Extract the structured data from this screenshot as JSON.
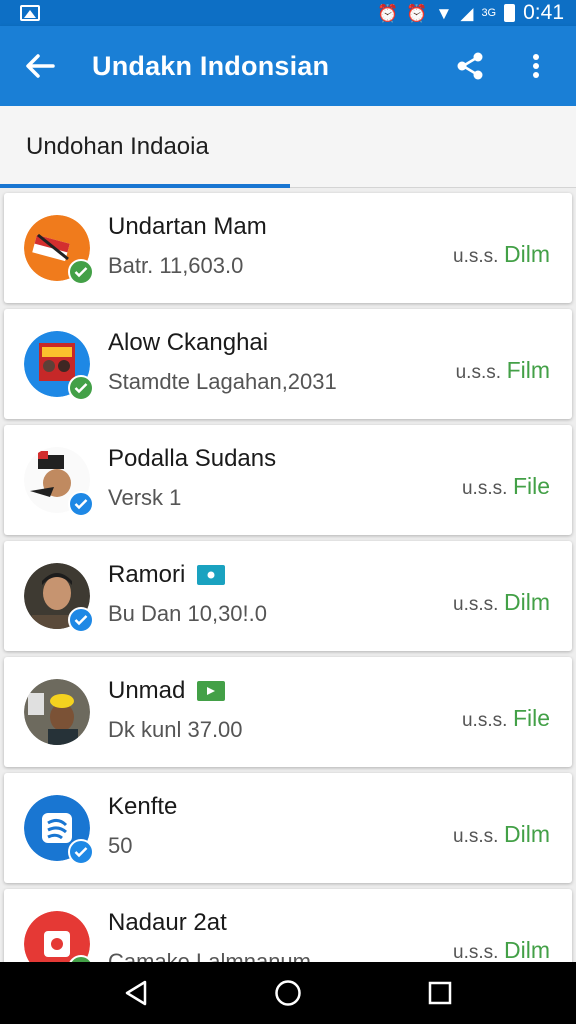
{
  "status_bar": {
    "network": "3G",
    "time": "0:41"
  },
  "app_bar": {
    "title": "Undakn Indonsian"
  },
  "tabs": [
    {
      "label": "Undohan Indaoia"
    }
  ],
  "items": [
    {
      "name": "Undartan Mam",
      "subtitle": "Batr. 11,603.0",
      "prefix": "u.s.s.",
      "type": "Dilm",
      "check": "green",
      "tag": ""
    },
    {
      "name": "Alow Ckanghai",
      "subtitle": "Stamdte Lagahan,2031",
      "prefix": "u.s.s.",
      "type": "Film",
      "check": "green",
      "tag": ""
    },
    {
      "name": "Podalla Sudans",
      "subtitle": "Versk 1",
      "prefix": "u.s.s.",
      "type": "File",
      "check": "blue",
      "tag": ""
    },
    {
      "name": "Ramori",
      "subtitle": "Bu Dan 10,30!.0",
      "prefix": "u.s.s.",
      "type": "Dilm",
      "check": "blue",
      "tag": "teal"
    },
    {
      "name": "Unmad",
      "subtitle": "Dk kunl 37.00",
      "prefix": "u.s.s.",
      "type": "File",
      "check": "",
      "tag": "green"
    },
    {
      "name": "Kenfte",
      "subtitle": "50",
      "prefix": "u.s.s.",
      "type": "Dilm",
      "check": "blue",
      "tag": ""
    },
    {
      "name": "Nadaur 2at",
      "subtitle": "Camake Lalmnanum",
      "prefix": "u.s.s.",
      "type": "Dilm",
      "check": "green",
      "tag": ""
    }
  ],
  "colors": {
    "app_bar": "#1a7fd6",
    "status_bar": "#0d6fc5",
    "accent": "#1976d2",
    "type_text": "#43a047"
  }
}
